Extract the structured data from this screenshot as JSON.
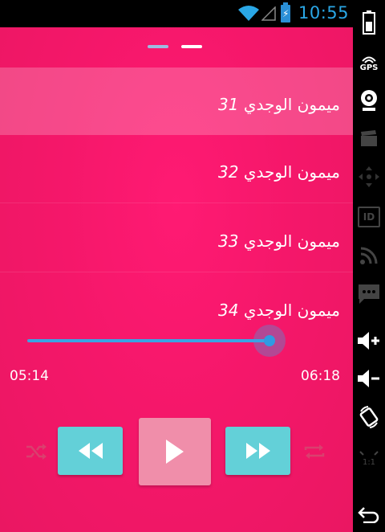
{
  "status_bar": {
    "time": "10:55"
  },
  "pager": {
    "pages": 2,
    "current": 2
  },
  "tracks": [
    {
      "name": "ميمون الوجدي",
      "number": "31",
      "selected": true
    },
    {
      "name": "ميمون الوجدي",
      "number": "32",
      "selected": false
    },
    {
      "name": "ميمون الوجدي",
      "number": "33",
      "selected": false
    },
    {
      "name": "ميمون الوجدي",
      "number": "34",
      "selected": false
    }
  ],
  "player": {
    "current_time": "05:14",
    "total_time": "06:18",
    "progress": 0.83
  },
  "system_bar": {
    "gps_label": "GPS",
    "id_label": "ID",
    "ratio_label": "1:1"
  },
  "colors": {
    "background": "#f5176a",
    "accent_blue": "#3aa3e4",
    "control_teal": "#63d0d8",
    "play_pink": "#f08eaa"
  }
}
